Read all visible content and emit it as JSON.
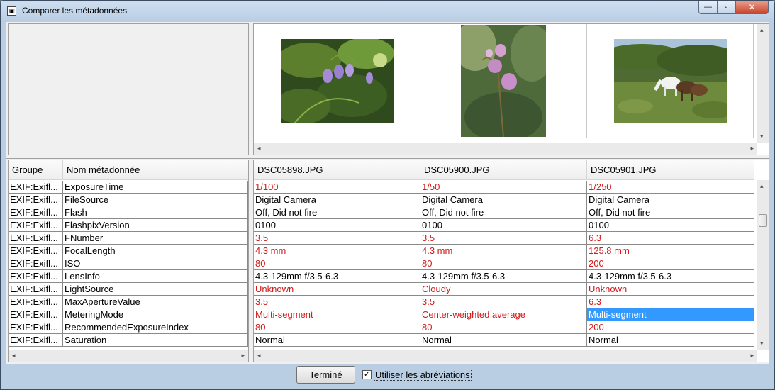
{
  "window": {
    "title": "Comparer les métadonnées",
    "controls": {
      "minimize": "—",
      "maximize": "▫",
      "close": "✕"
    }
  },
  "thumbnails": [
    {
      "file": "DSC05898.JPG",
      "subject": "purple bell flowers"
    },
    {
      "file": "DSC05900.JPG",
      "subject": "pink drooping flowers"
    },
    {
      "file": "DSC05901.JPG",
      "subject": "horses on hillside"
    }
  ],
  "table": {
    "left_headers": [
      "Groupe",
      "Nom métadonnée"
    ],
    "right_headers": [
      "DSC05898.JPG",
      "DSC05900.JPG",
      "DSC05901.JPG"
    ],
    "rows": [
      {
        "group": "EXIF:Exifl...",
        "name": "ExposureTime",
        "values": [
          "1/100",
          "1/50",
          "1/250"
        ],
        "diff": true
      },
      {
        "group": "EXIF:Exifl...",
        "name": "FileSource",
        "values": [
          "Digital Camera",
          "Digital Camera",
          "Digital Camera"
        ],
        "diff": false
      },
      {
        "group": "EXIF:Exifl...",
        "name": "Flash",
        "values": [
          "Off, Did not fire",
          "Off, Did not fire",
          "Off, Did not fire"
        ],
        "diff": false
      },
      {
        "group": "EXIF:Exifl...",
        "name": "FlashpixVersion",
        "values": [
          "0100",
          "0100",
          "0100"
        ],
        "diff": false
      },
      {
        "group": "EXIF:Exifl...",
        "name": "FNumber",
        "values": [
          "3.5",
          "3.5",
          "6.3"
        ],
        "diff": true
      },
      {
        "group": "EXIF:Exifl...",
        "name": "FocalLength",
        "values": [
          "4.3 mm",
          "4.3 mm",
          "125.8 mm"
        ],
        "diff": true
      },
      {
        "group": "EXIF:Exifl...",
        "name": "ISO",
        "values": [
          "80",
          "80",
          "200"
        ],
        "diff": true
      },
      {
        "group": "EXIF:Exifl...",
        "name": "LensInfo",
        "values": [
          "4.3-129mm f/3.5-6.3",
          "4.3-129mm f/3.5-6.3",
          "4.3-129mm f/3.5-6.3"
        ],
        "diff": false
      },
      {
        "group": "EXIF:Exifl...",
        "name": "LightSource",
        "values": [
          "Unknown",
          "Cloudy",
          "Unknown"
        ],
        "diff": true
      },
      {
        "group": "EXIF:Exifl...",
        "name": "MaxApertureValue",
        "values": [
          "3.5",
          "3.5",
          "6.3"
        ],
        "diff": true
      },
      {
        "group": "EXIF:Exifl...",
        "name": "MeteringMode",
        "values": [
          "Multi-segment",
          "Center-weighted average",
          "Multi-segment"
        ],
        "diff": true,
        "selected_col": 2
      },
      {
        "group": "EXIF:Exifl...",
        "name": "RecommendedExposureIndex",
        "values": [
          "80",
          "80",
          "200"
        ],
        "diff": true
      },
      {
        "group": "EXIF:Exifl...",
        "name": "Saturation",
        "values": [
          "Normal",
          "Normal",
          "Normal"
        ],
        "diff": false
      }
    ]
  },
  "colors": {
    "diff_text": "#d21a1a",
    "selection": "#3399ff"
  },
  "footer": {
    "done_button": "Terminé",
    "abbrev_checkbox": "Utiliser les abréviations",
    "abbrev_checked": true,
    "check_glyph": "✓"
  },
  "scrollbars": {
    "left": "◂",
    "right": "▸",
    "up": "▴",
    "down": "▾"
  }
}
